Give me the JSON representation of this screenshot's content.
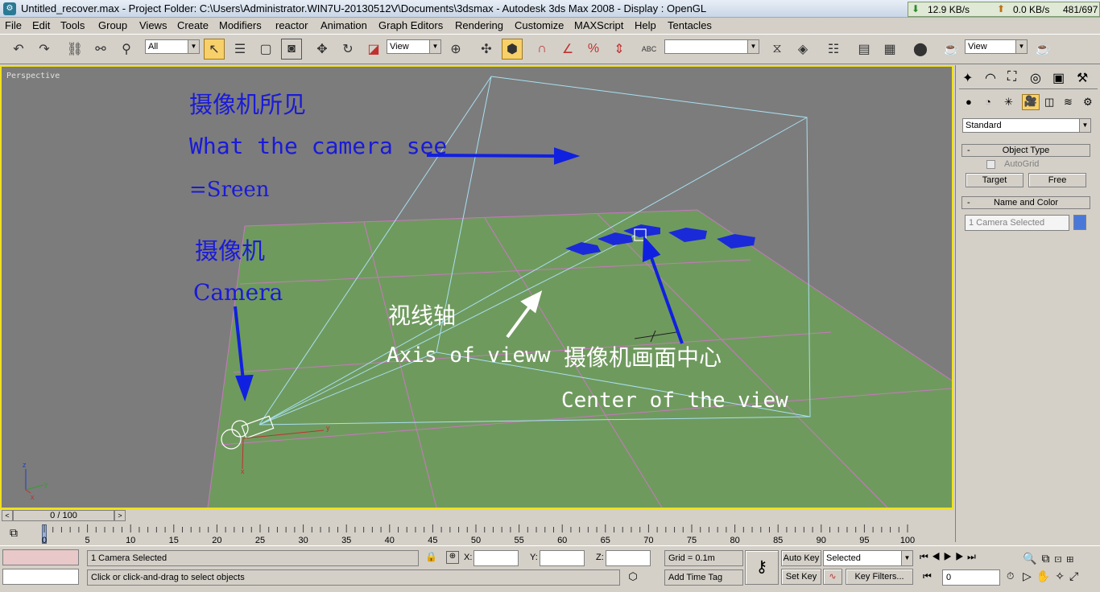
{
  "window": {
    "title": "Untitled_recover.max      - Project Folder: C:\\Users\\Administrator.WIN7U-20130512V\\Documents\\3dsmax      - Autodesk 3ds Max 2008      - Display : OpenGL",
    "net_down": "12.9 KB/s",
    "net_up": "0.0 KB/s",
    "net_count": "481/697"
  },
  "menu": {
    "file": "File",
    "edit": "Edit",
    "tools": "Tools",
    "group": "Group",
    "views": "Views",
    "create": "Create",
    "modifiers": "Modifiers",
    "reactor": "reactor",
    "animation": "Animation",
    "graph_editors": "Graph Editors",
    "rendering": "Rendering",
    "customize": "Customize",
    "maxscript": "MAXScript",
    "help": "Help",
    "tentacles": "Tentacles"
  },
  "toolbar": {
    "selection_filter": "All",
    "ref_coord": "View",
    "named_sel": "",
    "render_view": "View",
    "abc_label": "ABC"
  },
  "viewport": {
    "label": "Perspective",
    "annotations": {
      "camera_sees_cn": "摄像机所见",
      "camera_sees_en": "What the camera see",
      "screen_eq": "=Sreen",
      "camera_cn": "摄像机",
      "camera_en": "Camera",
      "axis_cn": "视线轴",
      "axis_en": "Axis of vieww",
      "center_cn": "摄像机画面中心",
      "center_en": "Center of the view"
    },
    "axis_labels": {
      "x": "x",
      "y": "y",
      "z": "z"
    },
    "colors": {
      "ground": "#6f9a5e",
      "background": "#7c7c7c",
      "frustum": "#a8e0f0",
      "arrow_blue": "#1020e0",
      "text_blue": "#1a1ad8"
    }
  },
  "command_panel": {
    "category": "Standard",
    "rollout_object_type": "Object Type",
    "autogrid": "AutoGrid",
    "btn_target": "Target",
    "btn_free": "Free",
    "rollout_name_color": "Name and Color",
    "name_field": "1 Camera Selected",
    "swatch_color": "#4a78d8",
    "rollout_minus": "-"
  },
  "timeline": {
    "frame": "0 / 100",
    "ticks": [
      "0",
      "5",
      "10",
      "15",
      "20",
      "25",
      "30",
      "35",
      "40",
      "45",
      "50",
      "55",
      "60",
      "65",
      "70",
      "75",
      "80",
      "85",
      "90",
      "95",
      "100"
    ]
  },
  "status": {
    "selection": "1 Camera Selected",
    "prompt": "Click or click-and-drag to select objects",
    "x_label": "X:",
    "y_label": "Y:",
    "z_label": "Z:",
    "x_value": "",
    "y_value": "",
    "z_value": "",
    "grid": "Grid = 0.1m",
    "add_time_tag": "Add Time Tag",
    "auto_key": "Auto Key",
    "set_key": "Set Key",
    "key_mode": "Selected",
    "key_filters": "Key Filters...",
    "current_frame": "0"
  }
}
